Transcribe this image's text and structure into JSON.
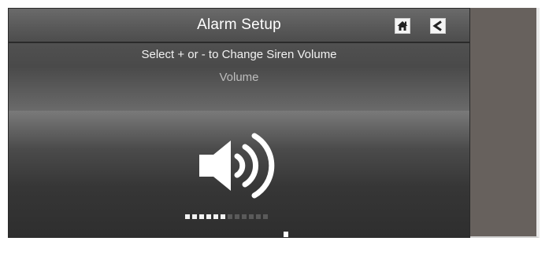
{
  "header": {
    "title": "Alarm Setup"
  },
  "instruction": "Select + or - to Change Siren Volume",
  "setting_label": "Volume",
  "volume": {
    "level": 6,
    "max": 12
  },
  "controls": {
    "decrease_icon": "minus-icon",
    "increase_icon": "plus-icon"
  },
  "icons": {
    "home": "home-icon",
    "back": "back-icon",
    "speaker": "speaker-volume-icon"
  },
  "colors": {
    "active_segment": "#f2f2f2",
    "inactive_segment": "#5a5a5a"
  }
}
